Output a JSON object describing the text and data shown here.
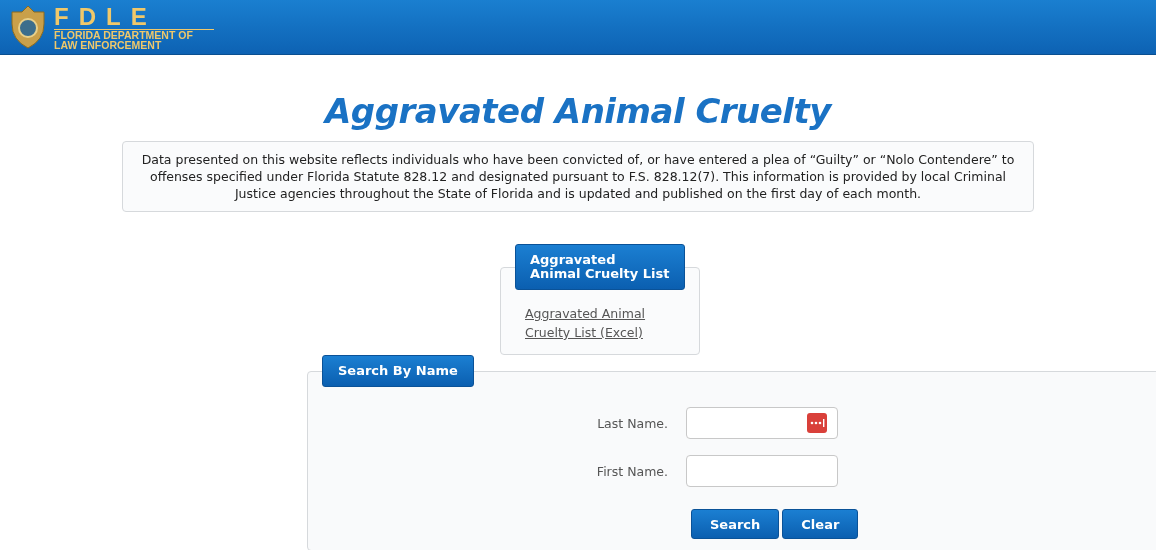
{
  "header": {
    "logo_title": "FDLE",
    "logo_subtitle_lines": [
      "FLORIDA DEPARTMENT OF",
      "LAW ENFORCEMENT"
    ]
  },
  "page_title": "Aggravated Animal Cruelty",
  "notice": "Data presented on this website reflects individuals who have been convicted of, or have entered a plea of “Guilty” or “Nolo Contendere” to offenses specified under Florida Statute 828.12 and designated pursuant to F.S. 828.12(7). This information is provided by local Criminal Justice agencies throughout the State of Florida and is updated and published on the first day of each month.",
  "list_panel": {
    "tab": "Aggravated Animal Cruelty List",
    "link": "Aggravated Animal Cruelty List (Excel)"
  },
  "search_panel": {
    "tab": "Search By Name",
    "fields": [
      {
        "label": "Last Name.",
        "kind": "password_manager"
      },
      {
        "label": "First Name.",
        "kind": "plain"
      }
    ],
    "buttons": [
      "Search",
      "Clear"
    ]
  }
}
